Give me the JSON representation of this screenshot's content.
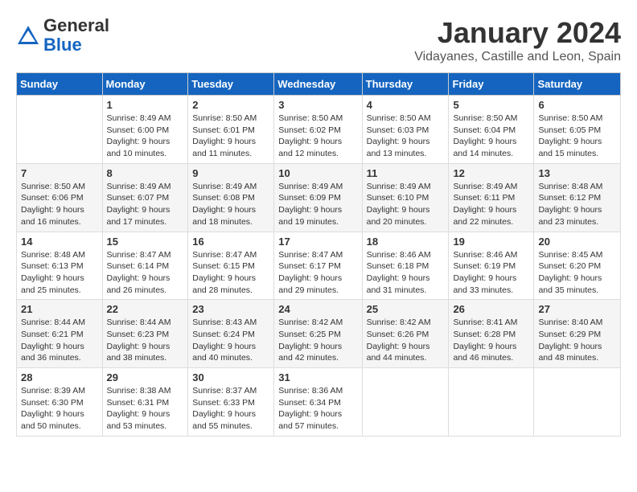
{
  "header": {
    "logo_general": "General",
    "logo_blue": "Blue",
    "month_title": "January 2024",
    "location": "Vidayanes, Castille and Leon, Spain"
  },
  "days_of_week": [
    "Sunday",
    "Monday",
    "Tuesday",
    "Wednesday",
    "Thursday",
    "Friday",
    "Saturday"
  ],
  "weeks": [
    [
      {
        "day": "",
        "sunrise": "",
        "sunset": "",
        "daylight": ""
      },
      {
        "day": "1",
        "sunrise": "Sunrise: 8:49 AM",
        "sunset": "Sunset: 6:00 PM",
        "daylight": "Daylight: 9 hours and 10 minutes."
      },
      {
        "day": "2",
        "sunrise": "Sunrise: 8:50 AM",
        "sunset": "Sunset: 6:01 PM",
        "daylight": "Daylight: 9 hours and 11 minutes."
      },
      {
        "day": "3",
        "sunrise": "Sunrise: 8:50 AM",
        "sunset": "Sunset: 6:02 PM",
        "daylight": "Daylight: 9 hours and 12 minutes."
      },
      {
        "day": "4",
        "sunrise": "Sunrise: 8:50 AM",
        "sunset": "Sunset: 6:03 PM",
        "daylight": "Daylight: 9 hours and 13 minutes."
      },
      {
        "day": "5",
        "sunrise": "Sunrise: 8:50 AM",
        "sunset": "Sunset: 6:04 PM",
        "daylight": "Daylight: 9 hours and 14 minutes."
      },
      {
        "day": "6",
        "sunrise": "Sunrise: 8:50 AM",
        "sunset": "Sunset: 6:05 PM",
        "daylight": "Daylight: 9 hours and 15 minutes."
      }
    ],
    [
      {
        "day": "7",
        "sunrise": "Sunrise: 8:50 AM",
        "sunset": "Sunset: 6:06 PM",
        "daylight": "Daylight: 9 hours and 16 minutes."
      },
      {
        "day": "8",
        "sunrise": "Sunrise: 8:49 AM",
        "sunset": "Sunset: 6:07 PM",
        "daylight": "Daylight: 9 hours and 17 minutes."
      },
      {
        "day": "9",
        "sunrise": "Sunrise: 8:49 AM",
        "sunset": "Sunset: 6:08 PM",
        "daylight": "Daylight: 9 hours and 18 minutes."
      },
      {
        "day": "10",
        "sunrise": "Sunrise: 8:49 AM",
        "sunset": "Sunset: 6:09 PM",
        "daylight": "Daylight: 9 hours and 19 minutes."
      },
      {
        "day": "11",
        "sunrise": "Sunrise: 8:49 AM",
        "sunset": "Sunset: 6:10 PM",
        "daylight": "Daylight: 9 hours and 20 minutes."
      },
      {
        "day": "12",
        "sunrise": "Sunrise: 8:49 AM",
        "sunset": "Sunset: 6:11 PM",
        "daylight": "Daylight: 9 hours and 22 minutes."
      },
      {
        "day": "13",
        "sunrise": "Sunrise: 8:48 AM",
        "sunset": "Sunset: 6:12 PM",
        "daylight": "Daylight: 9 hours and 23 minutes."
      }
    ],
    [
      {
        "day": "14",
        "sunrise": "Sunrise: 8:48 AM",
        "sunset": "Sunset: 6:13 PM",
        "daylight": "Daylight: 9 hours and 25 minutes."
      },
      {
        "day": "15",
        "sunrise": "Sunrise: 8:47 AM",
        "sunset": "Sunset: 6:14 PM",
        "daylight": "Daylight: 9 hours and 26 minutes."
      },
      {
        "day": "16",
        "sunrise": "Sunrise: 8:47 AM",
        "sunset": "Sunset: 6:15 PM",
        "daylight": "Daylight: 9 hours and 28 minutes."
      },
      {
        "day": "17",
        "sunrise": "Sunrise: 8:47 AM",
        "sunset": "Sunset: 6:17 PM",
        "daylight": "Daylight: 9 hours and 29 minutes."
      },
      {
        "day": "18",
        "sunrise": "Sunrise: 8:46 AM",
        "sunset": "Sunset: 6:18 PM",
        "daylight": "Daylight: 9 hours and 31 minutes."
      },
      {
        "day": "19",
        "sunrise": "Sunrise: 8:46 AM",
        "sunset": "Sunset: 6:19 PM",
        "daylight": "Daylight: 9 hours and 33 minutes."
      },
      {
        "day": "20",
        "sunrise": "Sunrise: 8:45 AM",
        "sunset": "Sunset: 6:20 PM",
        "daylight": "Daylight: 9 hours and 35 minutes."
      }
    ],
    [
      {
        "day": "21",
        "sunrise": "Sunrise: 8:44 AM",
        "sunset": "Sunset: 6:21 PM",
        "daylight": "Daylight: 9 hours and 36 minutes."
      },
      {
        "day": "22",
        "sunrise": "Sunrise: 8:44 AM",
        "sunset": "Sunset: 6:23 PM",
        "daylight": "Daylight: 9 hours and 38 minutes."
      },
      {
        "day": "23",
        "sunrise": "Sunrise: 8:43 AM",
        "sunset": "Sunset: 6:24 PM",
        "daylight": "Daylight: 9 hours and 40 minutes."
      },
      {
        "day": "24",
        "sunrise": "Sunrise: 8:42 AM",
        "sunset": "Sunset: 6:25 PM",
        "daylight": "Daylight: 9 hours and 42 minutes."
      },
      {
        "day": "25",
        "sunrise": "Sunrise: 8:42 AM",
        "sunset": "Sunset: 6:26 PM",
        "daylight": "Daylight: 9 hours and 44 minutes."
      },
      {
        "day": "26",
        "sunrise": "Sunrise: 8:41 AM",
        "sunset": "Sunset: 6:28 PM",
        "daylight": "Daylight: 9 hours and 46 minutes."
      },
      {
        "day": "27",
        "sunrise": "Sunrise: 8:40 AM",
        "sunset": "Sunset: 6:29 PM",
        "daylight": "Daylight: 9 hours and 48 minutes."
      }
    ],
    [
      {
        "day": "28",
        "sunrise": "Sunrise: 8:39 AM",
        "sunset": "Sunset: 6:30 PM",
        "daylight": "Daylight: 9 hours and 50 minutes."
      },
      {
        "day": "29",
        "sunrise": "Sunrise: 8:38 AM",
        "sunset": "Sunset: 6:31 PM",
        "daylight": "Daylight: 9 hours and 53 minutes."
      },
      {
        "day": "30",
        "sunrise": "Sunrise: 8:37 AM",
        "sunset": "Sunset: 6:33 PM",
        "daylight": "Daylight: 9 hours and 55 minutes."
      },
      {
        "day": "31",
        "sunrise": "Sunrise: 8:36 AM",
        "sunset": "Sunset: 6:34 PM",
        "daylight": "Daylight: 9 hours and 57 minutes."
      },
      {
        "day": "",
        "sunrise": "",
        "sunset": "",
        "daylight": ""
      },
      {
        "day": "",
        "sunrise": "",
        "sunset": "",
        "daylight": ""
      },
      {
        "day": "",
        "sunrise": "",
        "sunset": "",
        "daylight": ""
      }
    ]
  ]
}
